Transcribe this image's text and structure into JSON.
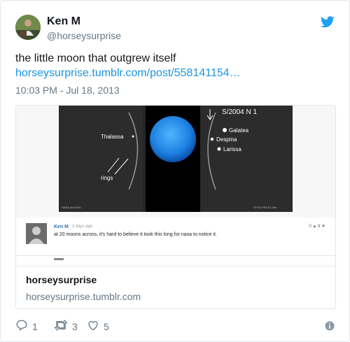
{
  "author": {
    "name": "Ken M",
    "handle": "@horseysurprise"
  },
  "tweet": {
    "text": "the little moon that outgrew itself",
    "link": "horseysurprise.tumblr.com/post/558141154…",
    "timestamp": "10:03 PM - Jul 18, 2013"
  },
  "card": {
    "image": {
      "labels": {
        "moon_id": "S/2004 N 1",
        "galatea": "Galatea",
        "despina": "Despina",
        "larissa": "Larissa",
        "thalassa": "Thalassa",
        "rings": "rings",
        "credit_left": "NASA and ESA",
        "credit_right": "STScI-PRC13-39a"
      },
      "comment": {
        "user": "Ken M",
        "time": "2 days ago",
        "text": "at 20 moons across, it's hard to believe it took this long for nasa to notice it.",
        "votes": "0 ▲   9 ▼"
      }
    },
    "title": "horseysurprise",
    "domain": "horseysurprise.tumblr.com"
  },
  "actions": {
    "replies": "1",
    "retweets": "3",
    "likes": "5"
  },
  "icons": [
    "twitter-bird-icon",
    "reply-icon",
    "retweet-icon",
    "heart-icon",
    "info-icon"
  ],
  "colors": {
    "link": "#1b95e0",
    "twitter_blue": "#1da1f2",
    "muted": "#657786"
  }
}
